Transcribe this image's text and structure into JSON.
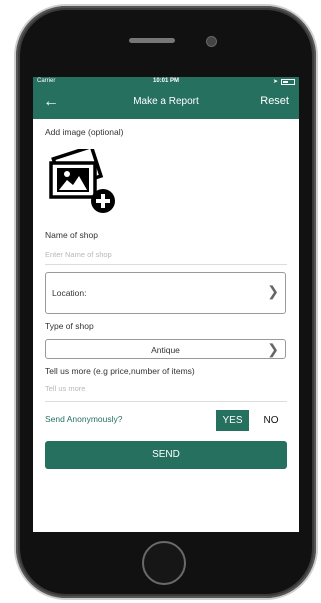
{
  "status_bar": {
    "carrier": "Carrier",
    "time": "10:01 PM"
  },
  "header": {
    "back_icon": "arrow-left-icon",
    "title": "Make a Report",
    "reset_label": "Reset"
  },
  "form": {
    "add_image_label": "Add image (optional)",
    "add_image_icon": "add-image-icon",
    "shop_name_label": "Name of shop",
    "shop_name_placeholder": "Enter Name of shop",
    "location_label": "Location:",
    "type_label": "Type of shop",
    "type_value": "Antique",
    "more_label": "Tell us more (e.g price,number of items)",
    "more_placeholder": "Tell us  more",
    "anonymous_label": "Send Anonymously?",
    "yes_label": "YES",
    "no_label": "NO",
    "anonymous_selected": "YES",
    "send_label": "SEND"
  },
  "colors": {
    "accent": "#267060",
    "background": "#ffffff"
  }
}
